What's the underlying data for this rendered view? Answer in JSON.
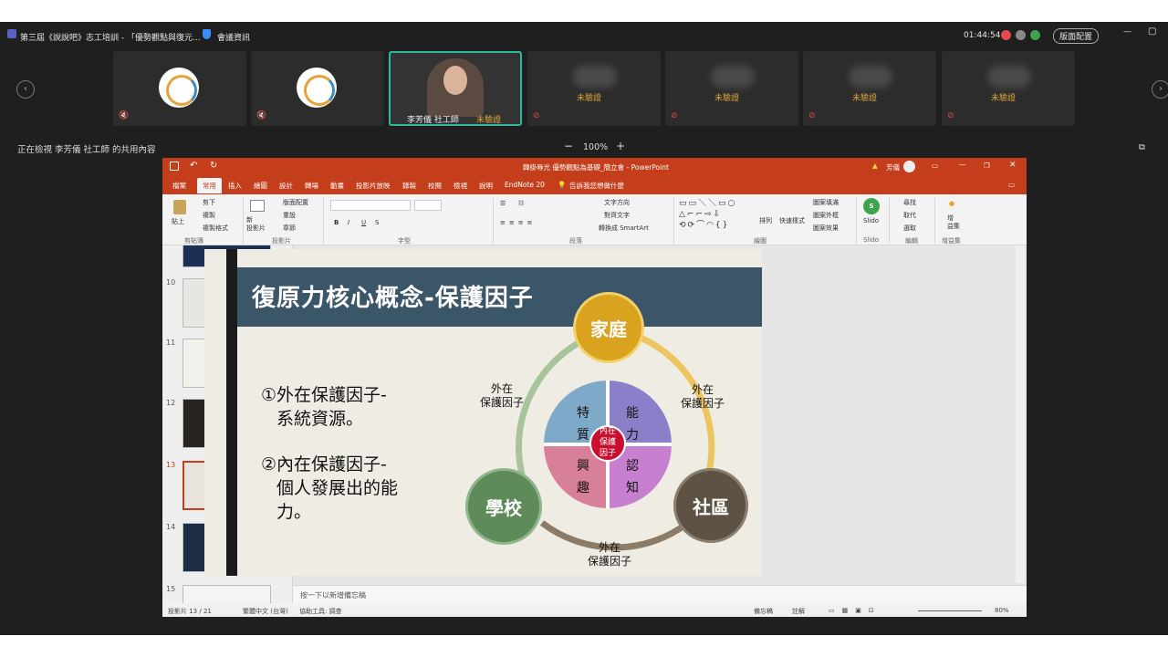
{
  "meeting": {
    "title": "第三屆《說說吧》志工培訓 - 「優勢觀點與復元...",
    "info_label": "會議資訊",
    "timer": "01:44:54",
    "layout_button": "版面配置",
    "viewing_text": "正在檢視 李芳儀 社工師 的共用內容",
    "zoom": "100%",
    "zoom_minus": "−",
    "zoom_plus": "+",
    "unverified": "未驗證",
    "speaker_name": "李芳儀 社工師",
    "speaker_status": "未驗證"
  },
  "ppt": {
    "window_title": "韓掛辱光 優勢觀點為基礎_簡立會  -  PowerPoint",
    "user": "芳儀",
    "tabs": [
      "檔案",
      "常用",
      "插入",
      "繪圖",
      "設計",
      "轉場",
      "動畫",
      "投影片放映",
      "錄製",
      "校閱",
      "檢視",
      "說明",
      "EndNote 20"
    ],
    "search": "告訴我您想做什麼",
    "ribbon": {
      "paste": "貼上",
      "cut": "剪下",
      "copy": "複製",
      "format_painter": "複製格式",
      "clipboard": "剪貼簿",
      "new_slide": "新\n投影片",
      "layout": "版面配置",
      "reset": "重設",
      "section": "章節",
      "slides": "投影片",
      "font": "字型",
      "text_direction": "文字方向",
      "align_text": "對齊文字",
      "smartart": "轉換成 SmartArt",
      "paragraph": "段落",
      "arrange": "排列",
      "quick_styles": "快速樣式",
      "shape_fill": "圖案填滿",
      "shape_outline": "圖案外框",
      "shape_effects": "圖案效果",
      "drawing": "繪圖",
      "slido": "Slido",
      "find": "尋找",
      "replace": "取代",
      "select": "選取",
      "editing": "編輯",
      "addins": "增\n益集",
      "addins_group": "增益集"
    },
    "thumb_numbers": [
      "10",
      "11",
      "12",
      "13",
      "14",
      "15"
    ],
    "notes_placeholder": "按一下以新增備忘稿",
    "status": {
      "slide": "投影片 13 / 21",
      "language": "繁體中文 (台灣)",
      "accessibility": "協助工具: 調查",
      "notes": "備忘稿",
      "comments": "註解",
      "zoom": "80%"
    }
  },
  "slide": {
    "title": "復原力核心概念-保護因子",
    "point1_line1": "①外在保護因子-",
    "point1_line2": "系統資源。",
    "point2_line1": "②內在保護因子-",
    "point2_line2": "個人發展出的能",
    "point2_line3": "力。",
    "family": "家庭",
    "school": "學校",
    "community": "社區",
    "outer_left": "外在\n保護因子",
    "outer_right": "外在\n保護因子",
    "outer_bottom": "外在\n保護因子",
    "q_trait": "特\n質",
    "q_ability": "能\n力",
    "q_interest": "興\n趣",
    "q_cognition": "認\n知",
    "inner": "內在\n保護\n因子",
    "colors": {
      "family": "#d9a21f",
      "school": "#5f8a5a",
      "community": "#5e5244",
      "trait": "#7fa9c9",
      "ability": "#8b7fc9",
      "interest": "#d87f99",
      "cognition": "#c77fd0",
      "inner": "#c8102e"
    }
  }
}
